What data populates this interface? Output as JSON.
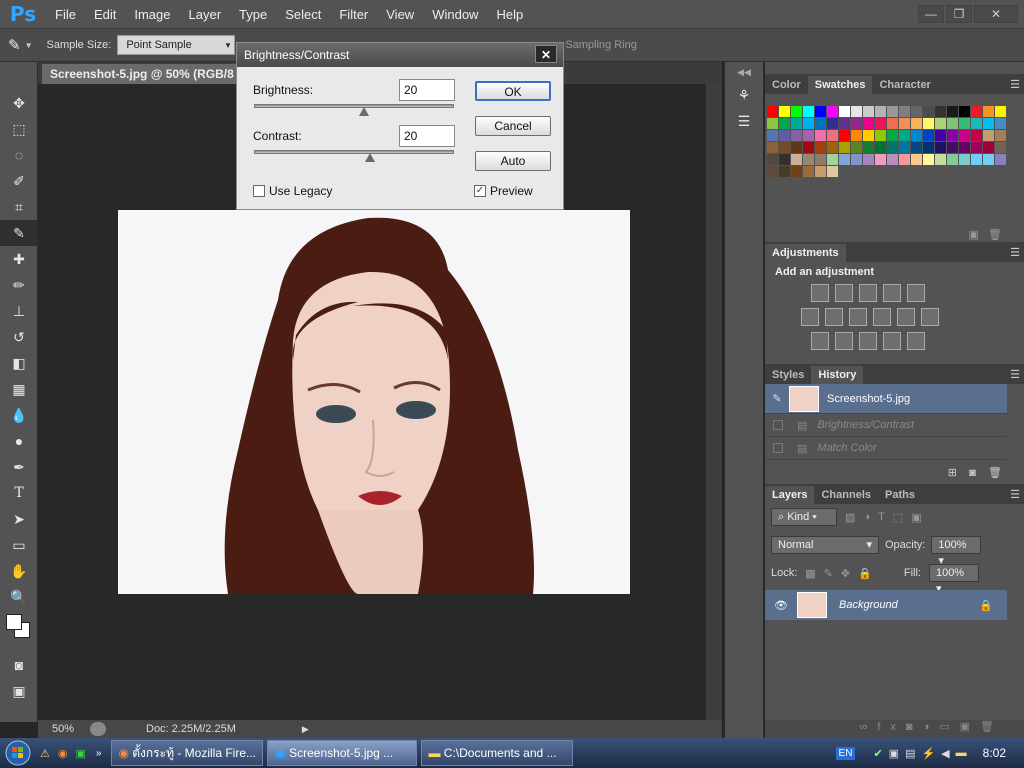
{
  "app": {
    "logo": "Ps"
  },
  "menu": [
    "File",
    "Edit",
    "Image",
    "Layer",
    "Type",
    "Select",
    "Filter",
    "View",
    "Window",
    "Help"
  ],
  "window_controls": {
    "minimize": "—",
    "restore": "❐",
    "close": "✕"
  },
  "options_bar": {
    "sample_size_label": "Sample Size:",
    "sample_size_value": "Point Sample",
    "sample_ring_label": "Sampling Ring"
  },
  "document": {
    "tab_title": "Screenshot-5.jpg @ 50% (RGB/8",
    "zoom": "50%",
    "doc_size": "Doc: 2.25M/2.25M"
  },
  "dialog": {
    "title": "Brightness/Contrast",
    "brightness_label": "Brightness:",
    "brightness_value": "20",
    "brightness_level": 0.55,
    "contrast_label": "Contrast:",
    "contrast_value": "20",
    "contrast_level": 0.58,
    "ok": "OK",
    "cancel": "Cancel",
    "auto": "Auto",
    "use_legacy_label": "Use Legacy",
    "use_legacy_checked": false,
    "preview_label": "Preview",
    "preview_checked": true,
    "close": "✕"
  },
  "color_panel": {
    "tabs": [
      "Color",
      "Swatches",
      "Character"
    ],
    "active_tab": "Swatches",
    "swatches": [
      "#ff0000",
      "#ffff00",
      "#00ff00",
      "#00ffff",
      "#0000ff",
      "#ff00ff",
      "#ffffff",
      "#e6e6e6",
      "#cccccc",
      "#b3b3b3",
      "#999999",
      "#808080",
      "#666666",
      "#4d4d4d",
      "#333333",
      "#1a1a1a",
      "#000000",
      "#ed1c24",
      "#f7941d",
      "#fff200",
      "#8dc63f",
      "#00a651",
      "#00a99d",
      "#00aeef",
      "#0072bc",
      "#2e3192",
      "#662d91",
      "#92278f",
      "#ec008c",
      "#ed145b",
      "#f26c4f",
      "#f68e55",
      "#fbaf5d",
      "#fff568",
      "#acd372",
      "#7cc576",
      "#3bb878",
      "#1abbb4",
      "#00bff3",
      "#438ccb",
      "#5574b9",
      "#605ca8",
      "#855fa8",
      "#a763a8",
      "#f06ea9",
      "#f26d7d",
      "#ff0000",
      "#ff8800",
      "#ffcc00",
      "#88cc00",
      "#00aa44",
      "#00aa88",
      "#0088cc",
      "#0044cc",
      "#4400aa",
      "#8800aa",
      "#cc0088",
      "#cc0044",
      "#c69c6d",
      "#a67c52",
      "#8c6239",
      "#754c24",
      "#603913",
      "#9e0b0f",
      "#a0410d",
      "#a36209",
      "#aba000",
      "#598527",
      "#197b30",
      "#007236",
      "#00746b",
      "#0076a3",
      "#004a80",
      "#003471",
      "#1b1464",
      "#440e62",
      "#630460",
      "#9e005d",
      "#9e0039",
      "#736357",
      "#534741",
      "#362f2d",
      "#c7b299",
      "#998675",
      "#8c7b6b",
      "#a3d39c",
      "#7da7d9",
      "#8393ca",
      "#a186be",
      "#f49ac1",
      "#bd8cbf",
      "#f5989d",
      "#fdc68a",
      "#fff799",
      "#c4df9b",
      "#82ca9c",
      "#7accc8",
      "#6dcff6",
      "#6ecff6",
      "#8881be",
      "#5c4a3a",
      "#4a3a2a",
      "#704214",
      "#9b6b3c",
      "#c89b6a",
      "#e0c7a0"
    ]
  },
  "adjustments": {
    "tab": "Adjustments",
    "heading": "Add an adjustment"
  },
  "history_panel": {
    "tabs": [
      "Styles",
      "History"
    ],
    "active_tab": "History",
    "snapshot": "Screenshot-5.jpg",
    "steps": [
      "Brightness/Contrast",
      "Match Color"
    ]
  },
  "layers_panel": {
    "tabs": [
      "Layers",
      "Channels",
      "Paths"
    ],
    "active_tab": "Layers",
    "filter_kind": "Kind",
    "blend_mode": "Normal",
    "opacity_label": "Opacity:",
    "opacity_value": "100%",
    "lock_label": "Lock:",
    "fill_label": "Fill:",
    "fill_value": "100%",
    "layers": [
      {
        "name": "Background",
        "locked": true,
        "visible": true
      }
    ]
  },
  "taskbar": {
    "items": [
      {
        "label": "ตั้งกระทู้ - Mozilla Fire...",
        "active": false
      },
      {
        "label": "Screenshot-5.jpg ...",
        "active": true
      },
      {
        "label": "C:\\Documents and ...",
        "active": false
      }
    ],
    "language": "EN",
    "clock": "8:02"
  },
  "colors": {
    "ui_bg": "#535353",
    "canvas_bg": "#282828",
    "accent": "#31a8ff",
    "selected_row": "#5a6e8e"
  }
}
